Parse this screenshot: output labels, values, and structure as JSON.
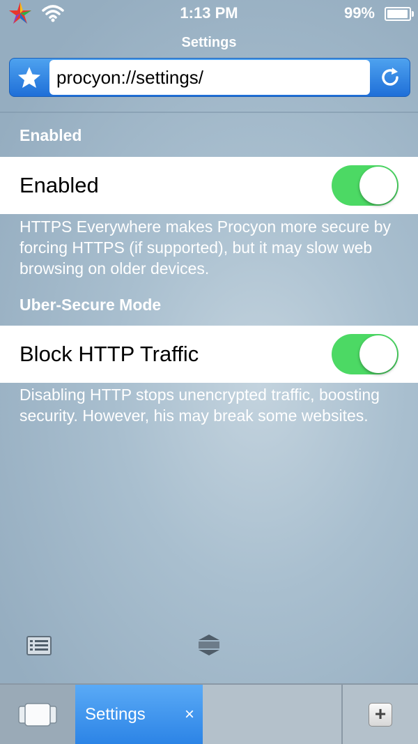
{
  "status_bar": {
    "time": "1:13 PM",
    "battery_percent": "99%"
  },
  "nav": {
    "title": "Settings"
  },
  "url_bar": {
    "value": "procyon://settings/"
  },
  "sections": [
    {
      "header": "Enabled",
      "row_label": "Enabled",
      "toggle_on": true,
      "footer": "HTTPS Everywhere makes Procyon more secure by forcing HTTPS (if supported), but it may slow web browsing on older devices."
    },
    {
      "header": "Uber-Secure Mode",
      "row_label": "Block HTTP Traffic",
      "toggle_on": true,
      "footer": "Disabling HTTP stops unencrypted traffic, boosting security. However, his may break some websites."
    }
  ],
  "tab_bar": {
    "active_tab_label": "Settings",
    "close_glyph": "×",
    "add_glyph": "+"
  },
  "icons": {
    "logo": "procyon-star-logo-icon",
    "wifi": "wifi-icon",
    "battery": "battery-icon",
    "bookmark": "star-bookmark-icon",
    "reload": "reload-icon",
    "reader": "list-reader-icon",
    "expand": "expand-collapse-icon",
    "tabs": "tab-switcher-icon",
    "add_tab": "add-tab-icon"
  },
  "colors": {
    "accent_blue": "#2c84e6",
    "toggle_on": "#4cd964"
  }
}
